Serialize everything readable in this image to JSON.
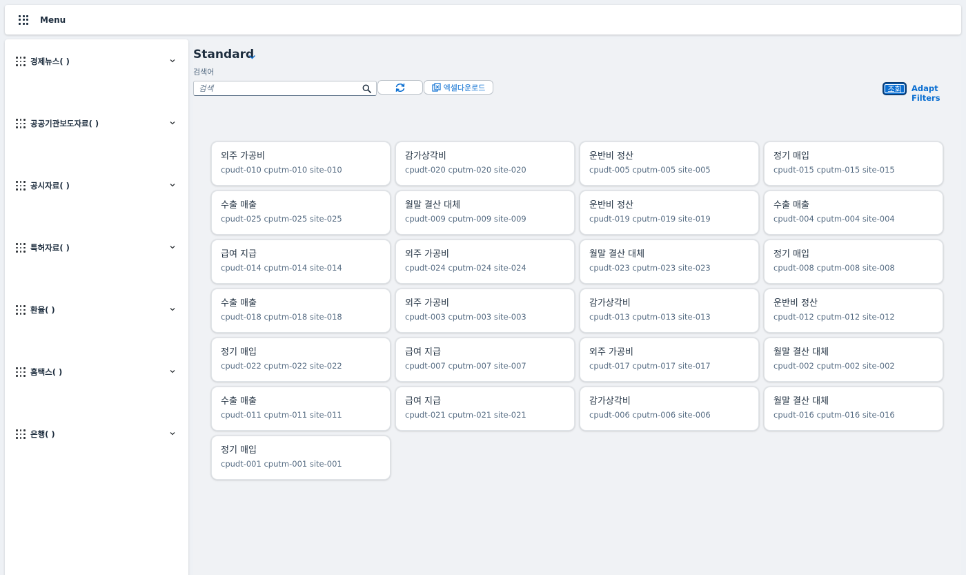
{
  "header": {
    "menu_label": "Menu"
  },
  "sidebar": {
    "items": [
      {
        "label": "경제뉴스( )"
      },
      {
        "label": "공공기관보도자료( )"
      },
      {
        "label": "공시자료( )"
      },
      {
        "label": "특허자료( )"
      },
      {
        "label": "환율( )"
      },
      {
        "label": "홈택스( )"
      },
      {
        "label": "은행( )"
      }
    ]
  },
  "main": {
    "variant_title": "Standard",
    "search_label": "검색어",
    "search_placeholder": "검색",
    "search_value": "",
    "excel_label": "엑셀다운로드",
    "go_label": "조회",
    "adapt_filters_label": "Adapt Filters"
  },
  "tiles": [
    {
      "title": "외주 가공비",
      "sub": "cpudt-010 cputm-010 site-010"
    },
    {
      "title": "감가상각비",
      "sub": "cpudt-020 cputm-020 site-020"
    },
    {
      "title": "운반비 정산",
      "sub": "cpudt-005 cputm-005 site-005"
    },
    {
      "title": "정기 매입",
      "sub": "cpudt-015 cputm-015 site-015"
    },
    {
      "title": "수출 매출",
      "sub": "cpudt-025 cputm-025 site-025"
    },
    {
      "title": "월말 결산 대체",
      "sub": "cpudt-009 cputm-009 site-009"
    },
    {
      "title": "운반비 정산",
      "sub": "cpudt-019 cputm-019 site-019"
    },
    {
      "title": "수출 매출",
      "sub": "cpudt-004 cputm-004 site-004"
    },
    {
      "title": "급여 지급",
      "sub": "cpudt-014 cputm-014 site-014"
    },
    {
      "title": "외주 가공비",
      "sub": "cpudt-024 cputm-024 site-024"
    },
    {
      "title": "월말 결산 대체",
      "sub": "cpudt-023 cputm-023 site-023"
    },
    {
      "title": "정기 매입",
      "sub": "cpudt-008 cputm-008 site-008"
    },
    {
      "title": "수출 매출",
      "sub": "cpudt-018 cputm-018 site-018"
    },
    {
      "title": "외주 가공비",
      "sub": "cpudt-003 cputm-003 site-003"
    },
    {
      "title": "감가상각비",
      "sub": "cpudt-013 cputm-013 site-013"
    },
    {
      "title": "운반비 정산",
      "sub": "cpudt-012 cputm-012 site-012"
    },
    {
      "title": "정기 매입",
      "sub": "cpudt-022 cputm-022 site-022"
    },
    {
      "title": "급여 지급",
      "sub": "cpudt-007 cputm-007 site-007"
    },
    {
      "title": "외주 가공비",
      "sub": "cpudt-017 cputm-017 site-017"
    },
    {
      "title": "월말 결산 대체",
      "sub": "cpudt-002 cputm-002 site-002"
    },
    {
      "title": "수출 매출",
      "sub": "cpudt-011 cputm-011 site-011"
    },
    {
      "title": "급여 지급",
      "sub": "cpudt-021 cputm-021 site-021"
    },
    {
      "title": "감가상각비",
      "sub": "cpudt-006 cputm-006 site-006"
    },
    {
      "title": "월말 결산 대체",
      "sub": "cpudt-016 cputm-016 site-016"
    },
    {
      "title": "정기 매입",
      "sub": "cpudt-001 cputm-001 site-001"
    }
  ],
  "colors": {
    "accent": "#0a6ed1",
    "background": "#f0f2f5",
    "text": "#1d2d3e",
    "subtext": "#556b82"
  }
}
